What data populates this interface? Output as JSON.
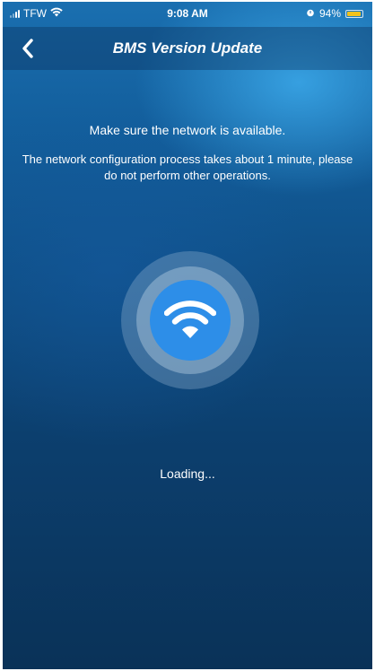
{
  "status_bar": {
    "carrier": "TFW",
    "time": "9:08 AM",
    "battery_percent": "94%",
    "battery_level": 0.94,
    "battery_color": "#f2c21b"
  },
  "nav": {
    "back_icon": "chevron-left-icon",
    "title": "BMS Version Update"
  },
  "content": {
    "message_primary": "Make sure the network is available.",
    "message_secondary": "The network configuration process takes about 1 minute, please do not perform other operations.",
    "status_icon": "wifi-icon",
    "status_icon_color": "#2d8ee8",
    "loading_text": "Loading..."
  }
}
